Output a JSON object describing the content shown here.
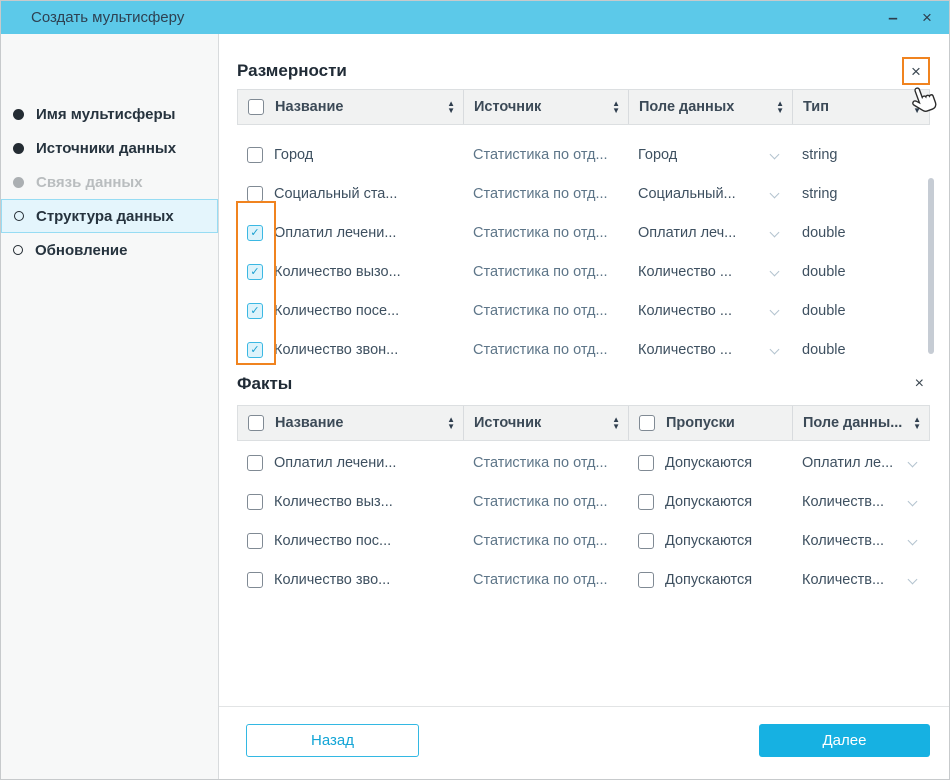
{
  "window": {
    "title": "Создать мультисферу",
    "minimize_icon": "–",
    "close_icon": "×"
  },
  "sidebar": {
    "items": [
      {
        "label": "Имя мультисферы",
        "state": "done"
      },
      {
        "label": "Источники данных",
        "state": "done"
      },
      {
        "label": "Связь данных",
        "state": "disabled"
      },
      {
        "label": "Структура данных",
        "state": "active"
      },
      {
        "label": "Обновление",
        "state": "pending"
      }
    ]
  },
  "dimensions": {
    "title": "Размерности",
    "close_icon": "×",
    "columns": [
      {
        "label": "Название"
      },
      {
        "label": "Источник"
      },
      {
        "label": "Поле данных"
      },
      {
        "label": "Тип"
      }
    ],
    "rows": [
      {
        "checked": false,
        "name": "Город",
        "source": "Статистика по отд...",
        "field": "Город",
        "type": "string"
      },
      {
        "checked": false,
        "name": "Социальный ста...",
        "source": "Статистика по отд...",
        "field": "Социальный...",
        "type": "string"
      },
      {
        "checked": true,
        "name": "Оплатил лечени...",
        "source": "Статистика по отд...",
        "field": "Оплатил леч...",
        "type": "double"
      },
      {
        "checked": true,
        "name": "Количество вызо...",
        "source": "Статистика по отд...",
        "field": "Количество ...",
        "type": "double"
      },
      {
        "checked": true,
        "name": "Количество посе...",
        "source": "Статистика по отд...",
        "field": "Количество ...",
        "type": "double"
      },
      {
        "checked": true,
        "name": "Количество звон...",
        "source": "Статистика по отд...",
        "field": "Количество ...",
        "type": "double"
      }
    ]
  },
  "facts": {
    "title": "Факты",
    "close_icon": "×",
    "columns": [
      {
        "label": "Название"
      },
      {
        "label": "Источник"
      },
      {
        "label": "Пропуски"
      },
      {
        "label": "Поле данны..."
      }
    ],
    "rows": [
      {
        "checked": false,
        "name": "Оплатил лечени...",
        "source": "Статистика по отд...",
        "gaps_checked": false,
        "gaps": "Допускаются",
        "field": "Оплатил ле..."
      },
      {
        "checked": false,
        "name": "Количество выз...",
        "source": "Статистика по отд...",
        "gaps_checked": false,
        "gaps": "Допускаются",
        "field": "Количеств..."
      },
      {
        "checked": false,
        "name": "Количество пос...",
        "source": "Статистика по отд...",
        "gaps_checked": false,
        "gaps": "Допускаются",
        "field": "Количеств..."
      },
      {
        "checked": false,
        "name": "Количество зво...",
        "source": "Статистика по отд...",
        "gaps_checked": false,
        "gaps": "Допускаются",
        "field": "Количеств..."
      }
    ]
  },
  "footer": {
    "back_label": "Назад",
    "next_label": "Далее"
  },
  "annotations": {
    "highlight_color": "#f0831f",
    "highlighted_elements": [
      "dimensions-close-button",
      "checked-dimension-checkboxes"
    ]
  }
}
